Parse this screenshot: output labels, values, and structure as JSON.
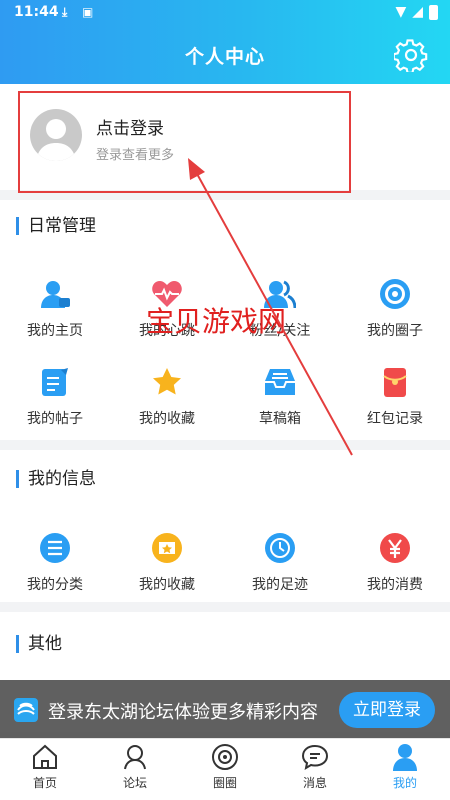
{
  "status_bar": {
    "time": "11:44"
  },
  "header": {
    "title": "个人中心"
  },
  "login": {
    "title": "点击登录",
    "subtitle": "登录查看更多"
  },
  "daily": {
    "title": "日常管理",
    "items": [
      {
        "label": "我的主页",
        "icon": "user-home-icon"
      },
      {
        "label": "我的心跳",
        "icon": "heartbeat-icon"
      },
      {
        "label": "粉丝/关注",
        "icon": "followers-icon"
      },
      {
        "label": "我的圈子",
        "icon": "circle-target-icon"
      },
      {
        "label": "我的帖子",
        "icon": "post-edit-icon"
      },
      {
        "label": "我的收藏",
        "icon": "star-icon"
      },
      {
        "label": "草稿箱",
        "icon": "inbox-icon"
      },
      {
        "label": "红包记录",
        "icon": "red-envelope-icon"
      }
    ]
  },
  "info": {
    "title": "我的信息",
    "items": [
      {
        "label": "我的分类",
        "icon": "list-icon"
      },
      {
        "label": "我的收藏",
        "icon": "favorites-icon"
      },
      {
        "label": "我的足迹",
        "icon": "clock-icon"
      },
      {
        "label": "我的消费",
        "icon": "yen-icon"
      }
    ]
  },
  "other": {
    "title": "其他"
  },
  "watermark": "宝贝游戏网",
  "banner": {
    "text": "登录东太湖论坛体验更多精彩内容",
    "button": "立即登录"
  },
  "tabs": [
    {
      "label": "首页",
      "icon": "home-icon"
    },
    {
      "label": "论坛",
      "icon": "forum-icon"
    },
    {
      "label": "圈圈",
      "icon": "circle-icon"
    },
    {
      "label": "消息",
      "icon": "message-icon"
    },
    {
      "label": "我的",
      "icon": "profile-icon",
      "active": true
    }
  ],
  "colors": {
    "accent": "#2a9ef3",
    "header_start": "#2f9bf2",
    "header_end": "#23d7f3",
    "highlight": "#e43d3d"
  }
}
